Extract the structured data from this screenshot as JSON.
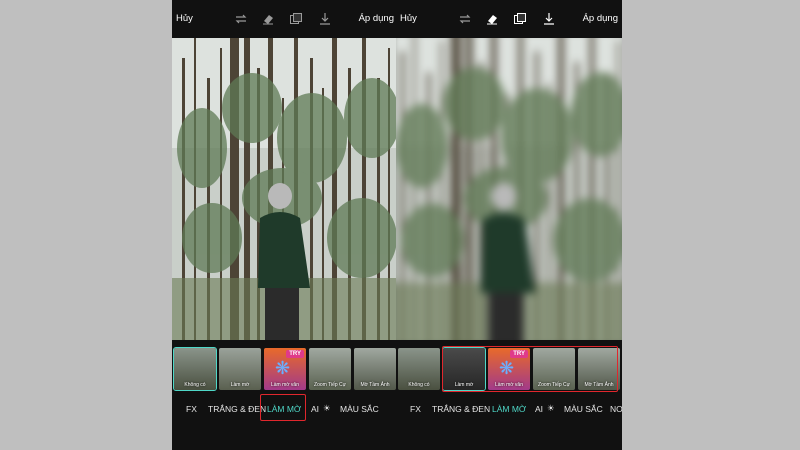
{
  "left": {
    "topbar": {
      "cancel": "Hủy",
      "apply": "Áp dụng"
    },
    "thumbs": [
      {
        "label": "Không có"
      },
      {
        "label": "Làm mờ"
      },
      {
        "label": "Làm mờ vân"
      },
      {
        "label": "Zoom Tiếp Cự"
      },
      {
        "label": "Mờ Tầm Ảnh"
      }
    ],
    "try_badge": "TRY",
    "tabs": [
      "FX",
      "TRẮNG & ĐEN",
      "LÀM MỜ",
      "AI",
      "MÀU SẮC"
    ],
    "active_tab": "LÀM MỜ"
  },
  "right": {
    "topbar": {
      "cancel": "Hủy",
      "apply": "Áp dụng"
    },
    "thumbs": [
      {
        "label": "Không có"
      },
      {
        "label": "Làm mờ"
      },
      {
        "label": "Làm mờ vân"
      },
      {
        "label": "Zoom Tiếp Cự"
      },
      {
        "label": "Mờ Tầm Ảnh"
      }
    ],
    "try_badge": "TRY",
    "tabs": [
      "FX",
      "TRẮNG & ĐEN",
      "LÀM MỜ",
      "AI",
      "MÀU SẮC",
      "NO"
    ],
    "active_tab": "LÀM MỜ"
  },
  "colors": {
    "accent": "#4fd8c8",
    "highlight": "#e0272d",
    "background": "#bfbfbf",
    "ui_dark": "#111111"
  },
  "icons": [
    "repeat-icon",
    "eraser-icon",
    "compare-icon",
    "download-icon",
    "sun-icon"
  ]
}
